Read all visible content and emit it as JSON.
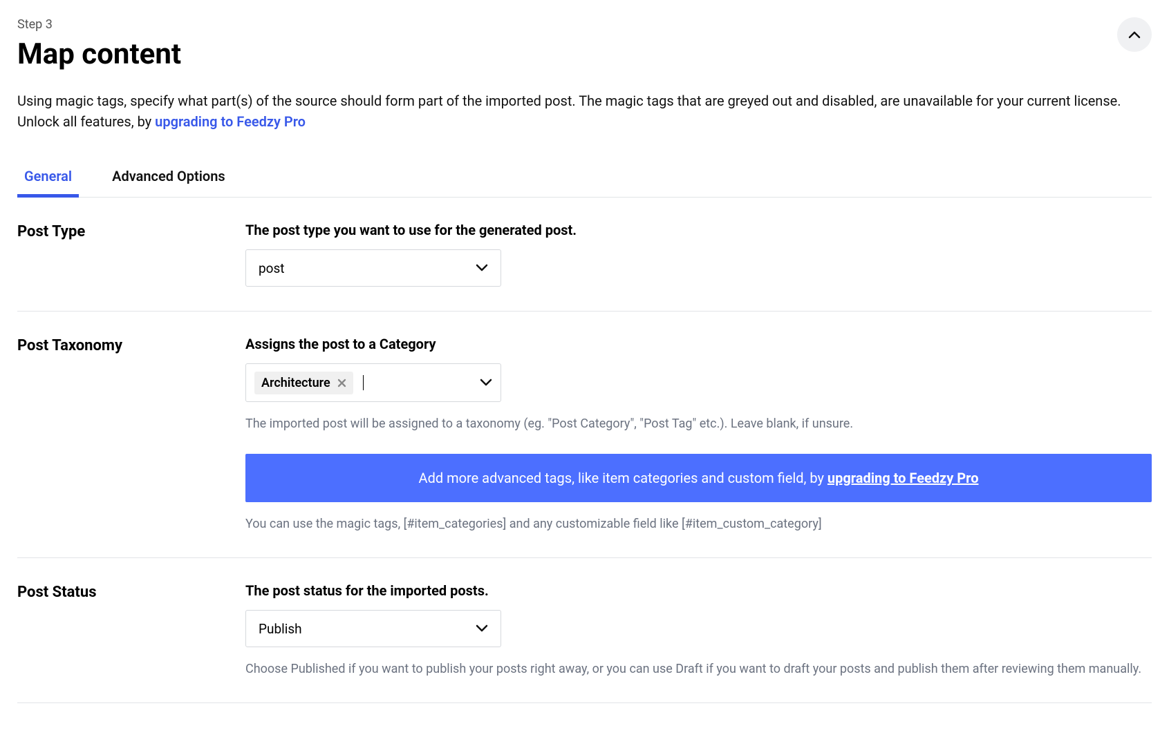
{
  "header": {
    "step": "Step 3",
    "title": "Map content",
    "description_before": "Using magic tags, specify what part(s) of the source should form part of the imported post. The magic tags that are greyed out and disabled, are unavailable for your current license. Unlock all features, by ",
    "description_link": "upgrading to Feedzy Pro"
  },
  "tabs": {
    "general": "General",
    "advanced": "Advanced Options"
  },
  "postType": {
    "label": "Post Type",
    "fieldLabel": "The post type you want to use for the generated post.",
    "value": "post"
  },
  "postTaxonomy": {
    "label": "Post Taxonomy",
    "fieldLabel": "Assigns the post to a Category",
    "tag": "Architecture",
    "help1": "The imported post will be assigned to a taxonomy (eg. \"Post Category\", \"Post Tag\" etc.). Leave blank, if unsure.",
    "promoBefore": "Add more advanced tags, like item categories and custom field, by ",
    "promoLink": "upgrading to Feedzy Pro",
    "help2": "You can use the magic tags, [#item_categories] and any customizable field like [#item_custom_category]"
  },
  "postStatus": {
    "label": "Post Status",
    "fieldLabel": "The post status for the imported posts.",
    "value": "Publish",
    "help": "Choose Published if you want to publish your posts right away, or you can use Draft if you want to draft your posts and publish them after reviewing them manually."
  }
}
